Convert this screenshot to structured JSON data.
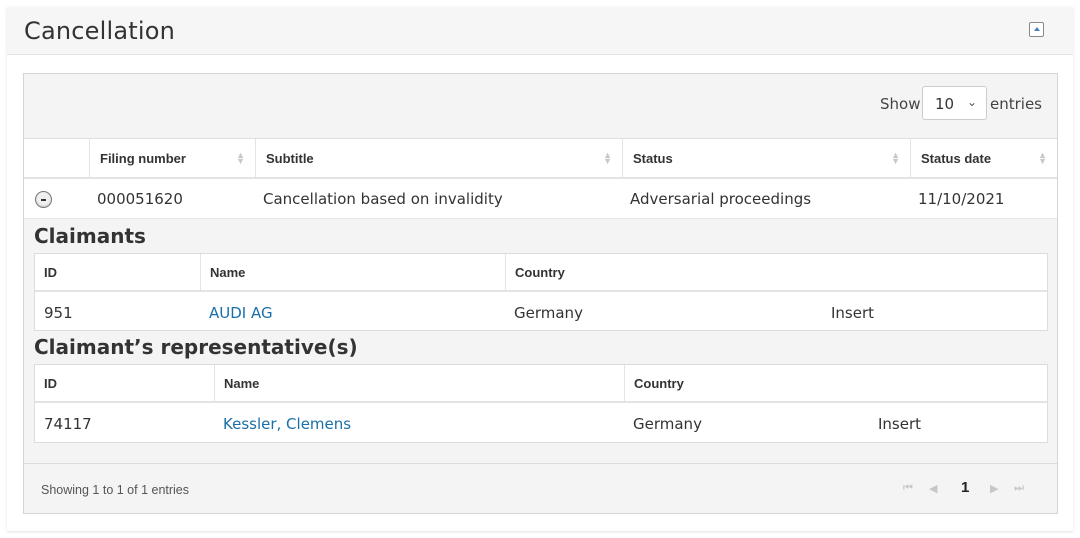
{
  "panel": {
    "title": "Cancellation",
    "collapse_icon": "collapse-up-icon"
  },
  "length_control": {
    "show_label": "Show",
    "selected": "10",
    "entries_label": "entries"
  },
  "table": {
    "columns": [
      "Filing number",
      "Subtitle",
      "Status",
      "Status date"
    ],
    "rows": [
      {
        "filing_number": "000051620",
        "subtitle": "Cancellation based on invalidity",
        "status": "Adversarial proceedings",
        "status_date": "11/10/2021"
      }
    ]
  },
  "claimants": {
    "title": "Claimants",
    "columns": [
      "ID",
      "Name",
      "Country"
    ],
    "rows": [
      {
        "id": "951",
        "name": "AUDI AG",
        "country": "Germany",
        "action": "Insert"
      }
    ]
  },
  "representatives": {
    "title": "Claimant’s representative(s)",
    "columns": [
      "ID",
      "Name",
      "Country"
    ],
    "rows": [
      {
        "id": "74117",
        "name": "Kessler, Clemens",
        "country": "Germany",
        "action": "Insert"
      }
    ]
  },
  "footer": {
    "info": "Showing 1 to 1 of 1 entries",
    "pager": {
      "first": "⏮",
      "prev": "◀",
      "current": "1",
      "next": "▶",
      "last": "⏭"
    }
  },
  "colors": {
    "link": "#1a6fa8",
    "header_bg": "#f6f6f6",
    "wrapper_bg": "#f4f4f4"
  }
}
